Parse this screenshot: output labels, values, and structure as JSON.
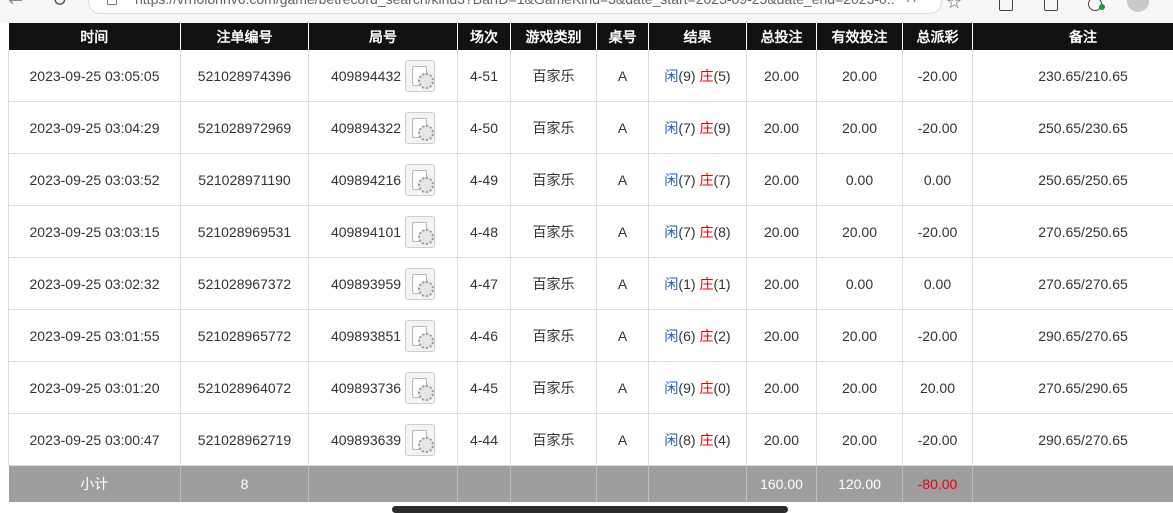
{
  "browser": {
    "url": "https://vrnoi8nhv6.com/game/betrecord_search/kind3?BarID=1&GameKind=3&date_start=2023-09-25&date_end=2023-0...",
    "read_aloud": "Aᵃ"
  },
  "table": {
    "headers": [
      "时间",
      "注单编号",
      "局号",
      "场次",
      "游戏类别",
      "桌号",
      "结果",
      "总投注",
      "有效投注",
      "总派彩",
      "备注"
    ],
    "rows": [
      {
        "time": "2023-09-25 03:05:05",
        "bet_id": "521028974396",
        "round": "409894432",
        "session": "4-51",
        "game": "百家乐",
        "table": "A",
        "player_label": "闲",
        "player_score": "(9)",
        "banker_label": "庄",
        "banker_score": "(5)",
        "total_bet": "20.00",
        "valid_bet": "20.00",
        "payout": "-20.00",
        "payout_negative": true,
        "remark": "230.65/210.65"
      },
      {
        "time": "2023-09-25 03:04:29",
        "bet_id": "521028972969",
        "round": "409894322",
        "session": "4-50",
        "game": "百家乐",
        "table": "A",
        "player_label": "闲",
        "player_score": "(7)",
        "banker_label": "庄",
        "banker_score": "(9)",
        "total_bet": "20.00",
        "valid_bet": "20.00",
        "payout": "-20.00",
        "payout_negative": true,
        "remark": "250.65/230.65"
      },
      {
        "time": "2023-09-25 03:03:52",
        "bet_id": "521028971190",
        "round": "409894216",
        "session": "4-49",
        "game": "百家乐",
        "table": "A",
        "player_label": "闲",
        "player_score": "(7)",
        "banker_label": "庄",
        "banker_score": "(7)",
        "total_bet": "20.00",
        "valid_bet": "0.00",
        "payout": "0.00",
        "payout_negative": false,
        "remark": "250.65/250.65"
      },
      {
        "time": "2023-09-25 03:03:15",
        "bet_id": "521028969531",
        "round": "409894101",
        "session": "4-48",
        "game": "百家乐",
        "table": "A",
        "player_label": "闲",
        "player_score": "(7)",
        "banker_label": "庄",
        "banker_score": "(8)",
        "total_bet": "20.00",
        "valid_bet": "20.00",
        "payout": "-20.00",
        "payout_negative": true,
        "remark": "270.65/250.65"
      },
      {
        "time": "2023-09-25 03:02:32",
        "bet_id": "521028967372",
        "round": "409893959",
        "session": "4-47",
        "game": "百家乐",
        "table": "A",
        "player_label": "闲",
        "player_score": "(1)",
        "banker_label": "庄",
        "banker_score": "(1)",
        "total_bet": "20.00",
        "valid_bet": "0.00",
        "payout": "0.00",
        "payout_negative": false,
        "remark": "270.65/270.65"
      },
      {
        "time": "2023-09-25 03:01:55",
        "bet_id": "521028965772",
        "round": "409893851",
        "session": "4-46",
        "game": "百家乐",
        "table": "A",
        "player_label": "闲",
        "player_score": "(6)",
        "banker_label": "庄",
        "banker_score": "(2)",
        "total_bet": "20.00",
        "valid_bet": "20.00",
        "payout": "-20.00",
        "payout_negative": true,
        "remark": "290.65/270.65"
      },
      {
        "time": "2023-09-25 03:01:20",
        "bet_id": "521028964072",
        "round": "409893736",
        "session": "4-45",
        "game": "百家乐",
        "table": "A",
        "player_label": "闲",
        "player_score": "(9)",
        "banker_label": "庄",
        "banker_score": "(0)",
        "total_bet": "20.00",
        "valid_bet": "20.00",
        "payout": "20.00",
        "payout_negative": false,
        "remark": "270.65/290.65"
      },
      {
        "time": "2023-09-25 03:00:47",
        "bet_id": "521028962719",
        "round": "409893639",
        "session": "4-44",
        "game": "百家乐",
        "table": "A",
        "player_label": "闲",
        "player_score": "(8)",
        "banker_label": "庄",
        "banker_score": "(4)",
        "total_bet": "20.00",
        "valid_bet": "20.00",
        "payout": "-20.00",
        "payout_negative": true,
        "remark": "290.65/270.65"
      }
    ],
    "subtotal": {
      "label": "小计",
      "count": "8",
      "total_bet": "160.00",
      "valid_bet": "120.00",
      "payout": "-80.00"
    }
  },
  "colors": {
    "header_bg": "#111111",
    "player_blue": "#1a5fd6",
    "banker_red": "#e8000b",
    "subtotal_bg": "#9e9e9e"
  },
  "icons": {
    "round_detail": "card-chip-detail-icon"
  }
}
